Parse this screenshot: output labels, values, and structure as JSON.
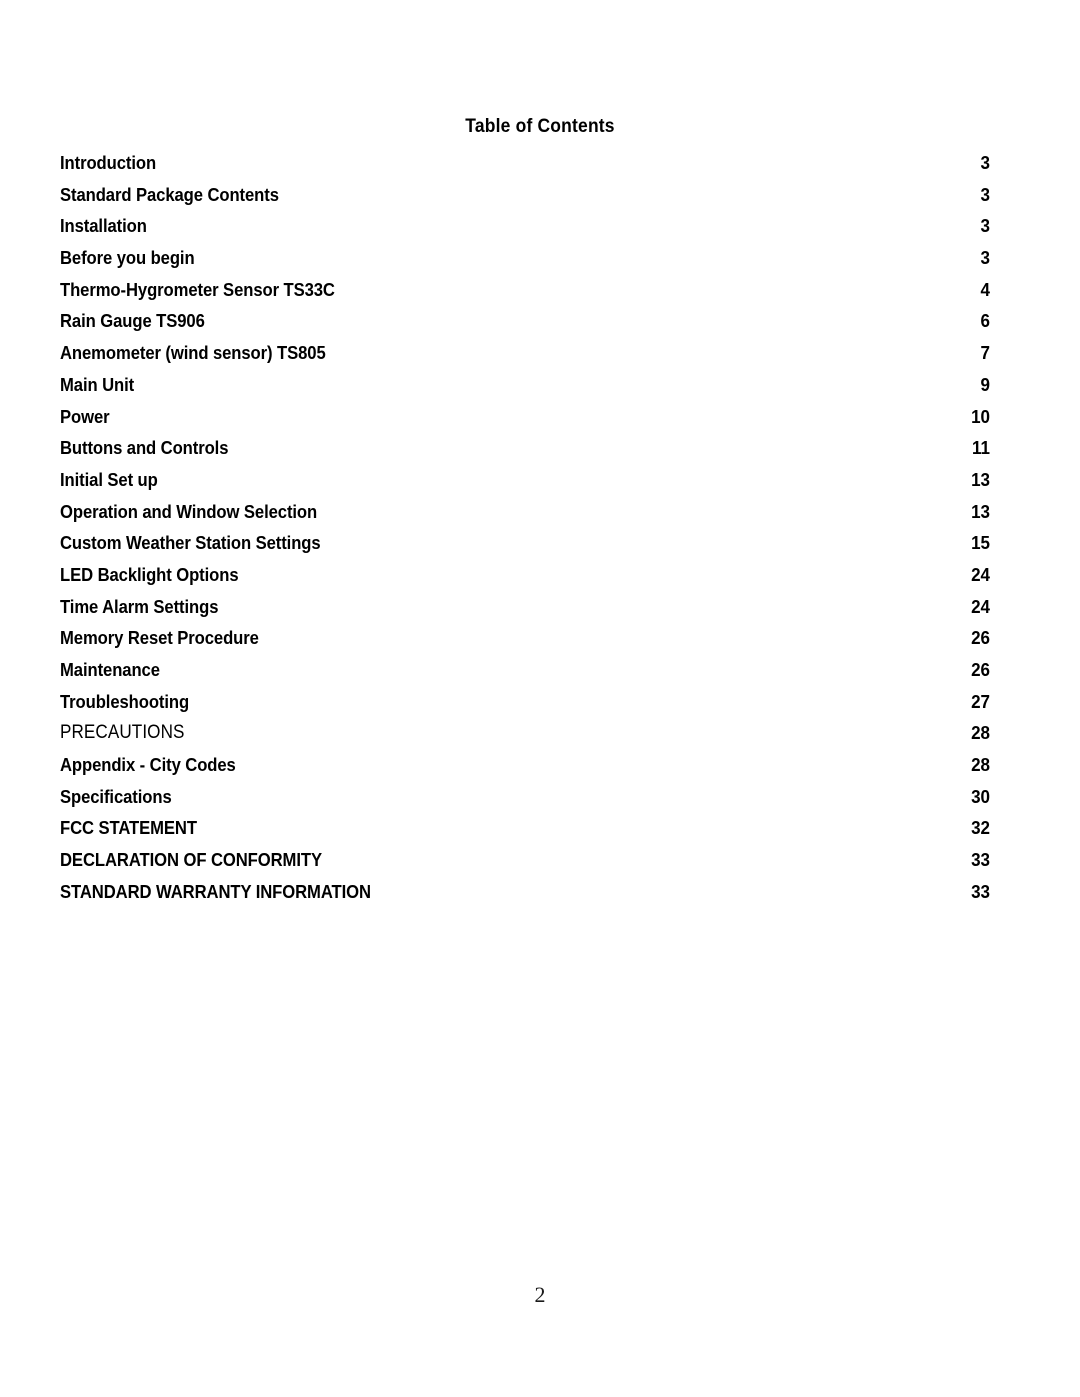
{
  "document": {
    "title": "Table of Contents",
    "footer_page_number": "2"
  },
  "toc": {
    "entries": [
      {
        "label": "Introduction",
        "page": "3",
        "weight": "bold"
      },
      {
        "label": "Standard Package Contents",
        "page": "3",
        "weight": "bold"
      },
      {
        "label": "Installation",
        "page": "3",
        "weight": "bold"
      },
      {
        "label": "Before you begin",
        "page": "3",
        "weight": "bold"
      },
      {
        "label": "Thermo-Hygrometer Sensor TS33C",
        "page": "4",
        "weight": "bold"
      },
      {
        "label": "Rain Gauge TS906",
        "page": "6",
        "weight": "bold"
      },
      {
        "label": "Anemometer (wind sensor) TS805",
        "page": "7",
        "weight": "bold"
      },
      {
        "label": "Main Unit",
        "page": "9",
        "weight": "bold"
      },
      {
        "label": "Power",
        "page": "10",
        "weight": "bold"
      },
      {
        "label": "Buttons and Controls",
        "page": "11",
        "weight": "bold"
      },
      {
        "label": "Initial Set up",
        "page": "13",
        "weight": "bold"
      },
      {
        "label": "Operation and Window Selection",
        "page": "13",
        "weight": "bold"
      },
      {
        "label": "Custom Weather Station Settings",
        "page": "15",
        "weight": "bold"
      },
      {
        "label": "LED Backlight Options",
        "page": "24",
        "weight": "bold"
      },
      {
        "label": "Time Alarm Settings",
        "page": "24",
        "weight": "bold"
      },
      {
        "label": "Memory Reset Procedure",
        "page": "26",
        "weight": "bold"
      },
      {
        "label": "Maintenance",
        "page": "26",
        "weight": "bold"
      },
      {
        "label": "Troubleshooting",
        "page": "27",
        "weight": "bold"
      },
      {
        "label": "PRECAUTIONS",
        "page": "28",
        "weight": "light"
      },
      {
        "label": "Appendix - City Codes",
        "page": "28",
        "weight": "bold"
      },
      {
        "label": "Specifications",
        "page": "30",
        "weight": "bold"
      },
      {
        "label": "FCC STATEMENT",
        "page": "32",
        "weight": "bold"
      },
      {
        "label": "DECLARATION OF CONFORMITY",
        "page": "33",
        "weight": "bold"
      },
      {
        "label": "STANDARD WARRANTY INFORMATION",
        "page": "33",
        "weight": "bold"
      }
    ]
  }
}
